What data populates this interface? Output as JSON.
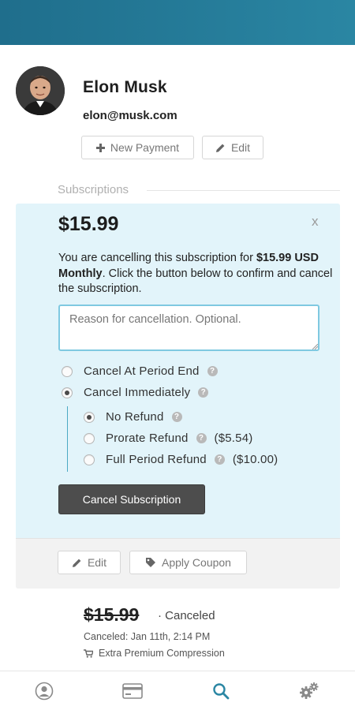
{
  "profile": {
    "name": "Elon Musk",
    "email": "elon@musk.com",
    "new_payment_label": "New Payment",
    "edit_label": "Edit"
  },
  "subscriptions": {
    "section_label": "Subscriptions",
    "active": {
      "price": "$15.99",
      "close_glyph": "x",
      "message_prefix": "You are cancelling this subscription for ",
      "message_bold": "$15.99 USD Monthly",
      "message_suffix": ". Click the button below to confirm and cancel the subscription.",
      "reason_placeholder": "Reason for cancellation. Optional.",
      "options": {
        "period_end": "Cancel At Period End",
        "immediately": "Cancel Immediately"
      },
      "refund_options": {
        "no_refund": "No Refund",
        "prorate": "Prorate Refund",
        "prorate_amount": "($5.54)",
        "full": "Full Period Refund",
        "full_amount": "($10.00)"
      },
      "help_glyph": "?",
      "cancel_button": "Cancel Subscription",
      "footer_edit": "Edit",
      "footer_coupon": "Apply Coupon",
      "selected_option": "immediately",
      "selected_refund": "no_refund"
    },
    "canceled": {
      "price": "$15.99",
      "status": "· Canceled",
      "date": "Canceled: Jan 11th, 2:14 PM",
      "product": "Extra Premium Compression"
    }
  },
  "nav": {
    "items": [
      "user-icon",
      "card-icon",
      "search-icon",
      "settings-icon"
    ],
    "active": "search-icon",
    "active_color": "#2a86a3",
    "inactive_color": "#8a8a8a"
  },
  "colors": {
    "header": "#1f6e8c",
    "panel": "#e2f4fa",
    "accent": "#4ba9c4"
  }
}
